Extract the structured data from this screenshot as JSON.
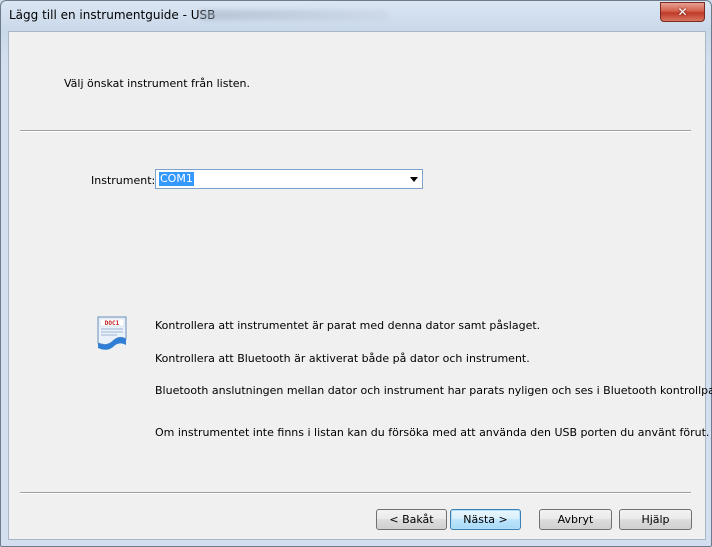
{
  "window": {
    "title": "Lägg till en instrumentguide - USB",
    "close_label": "✕"
  },
  "header": {
    "instruction": "Välj önskat instrument från listen."
  },
  "instrument": {
    "label": "Instrument:",
    "selected": "COM1"
  },
  "icon": {
    "name": "document-icon",
    "label": "DOC1"
  },
  "info": {
    "line1": "Kontrollera att instrumentet är parat med denna dator samt påslaget.",
    "line2": "Kontrollera att Bluetooth är aktiverat både på dator och instrument.",
    "line3": "Bluetooth anslutningen mellan dator och instrument har parats nyligen och ses i Bluetooth kontrollpanel.",
    "line4": "Om instrumentet inte finns i listan kan du försöka med att använda den USB porten du använt förut."
  },
  "buttons": {
    "back": "< Bakåt",
    "next": "Nästa >",
    "cancel": "Avbryt",
    "help": "Hjälp"
  }
}
